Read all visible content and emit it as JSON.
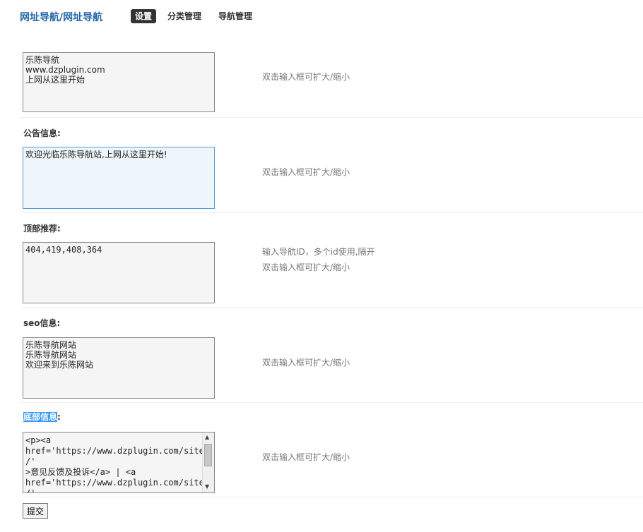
{
  "header": {
    "brand": "网址导航/网址导航",
    "tabs": [
      {
        "label": "设置",
        "active": true
      },
      {
        "label": "分类管理",
        "active": false
      },
      {
        "label": "导航管理",
        "active": false
      }
    ]
  },
  "fields": [
    {
      "label": "",
      "value": "乐陈导航\nwww.dzplugin.com\n上网从这里开始",
      "hint": "双击输入框可扩大/缩小"
    },
    {
      "label": "公告信息:",
      "value": "欢迎光临乐陈导航站,上网从这里开始!",
      "hint": "双击输入框可扩大/缩小"
    },
    {
      "label": "顶部推荐:",
      "value": "404,419,408,364",
      "hint_line1": "输入导航ID，多个id使用,隔开",
      "hint": "双击输入框可扩大/缩小"
    },
    {
      "label": "seo信息:",
      "value": "乐陈导航网站\n乐陈导航网站\n欢迎来到乐陈网站",
      "hint": "双击输入框可扩大/缩小"
    },
    {
      "label_highlight": "底部信息",
      "label_suffix": ":",
      "value": "<p><a\nhref='https://www.dzplugin.com/site/'\n>意见反馈及投诉</a> | <a\nhref='https://www.dzplugin.com/site/'\n>免责声明 </a> |  <a\nhref='https://www.dzplugin.com/site/'",
      "hint": "双击输入框可扩大/缩小"
    }
  ],
  "submit_label": "提交",
  "colors": {
    "brand": "#2366a8",
    "active_tab_bg": "#333333",
    "highlight": "#3399ff",
    "hint": "#777777"
  }
}
